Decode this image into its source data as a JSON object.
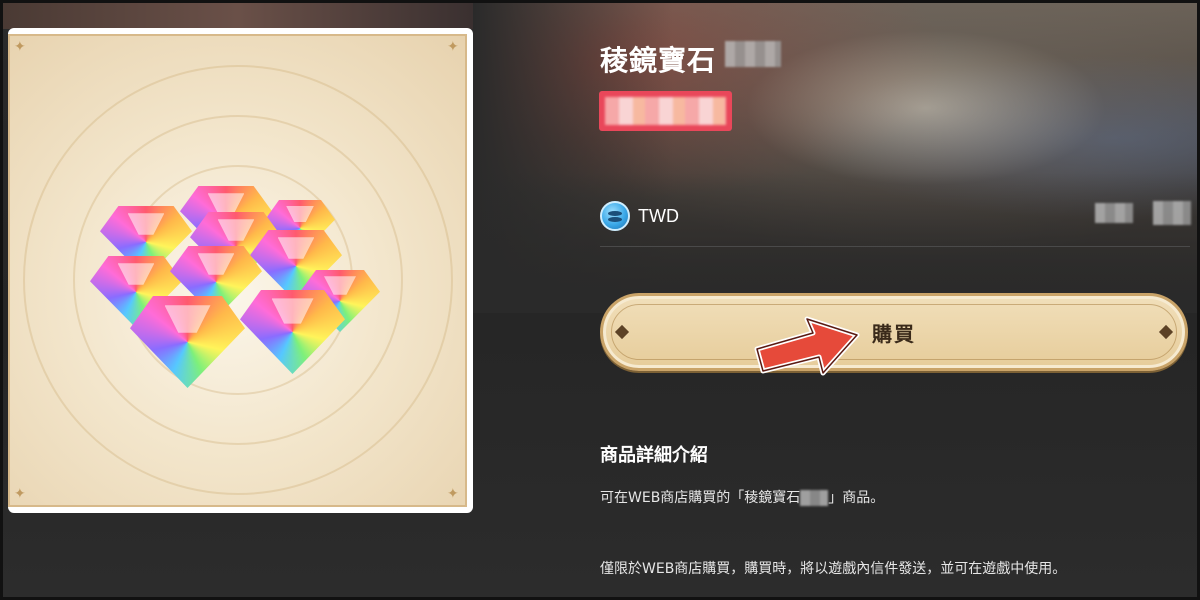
{
  "product": {
    "title": "稜鏡寶石",
    "image_alt": "rainbow prism gems pile"
  },
  "price": {
    "currency_icon": "coin-stack-icon",
    "currency": "TWD"
  },
  "buy_button": {
    "label": "購買"
  },
  "details": {
    "heading": "商品詳細介紹",
    "line1_prefix": "可在WEB商店購買的「稜鏡寶石",
    "line1_suffix": "」商品。",
    "line2": "僅限於WEB商店購買，購買時，將以遊戲內信件發送，並可在遊戲中使用。"
  },
  "colors": {
    "accent_badge": "#e9475a",
    "button_fill": "#ecd6aa",
    "arrow": "#e64a3a"
  }
}
